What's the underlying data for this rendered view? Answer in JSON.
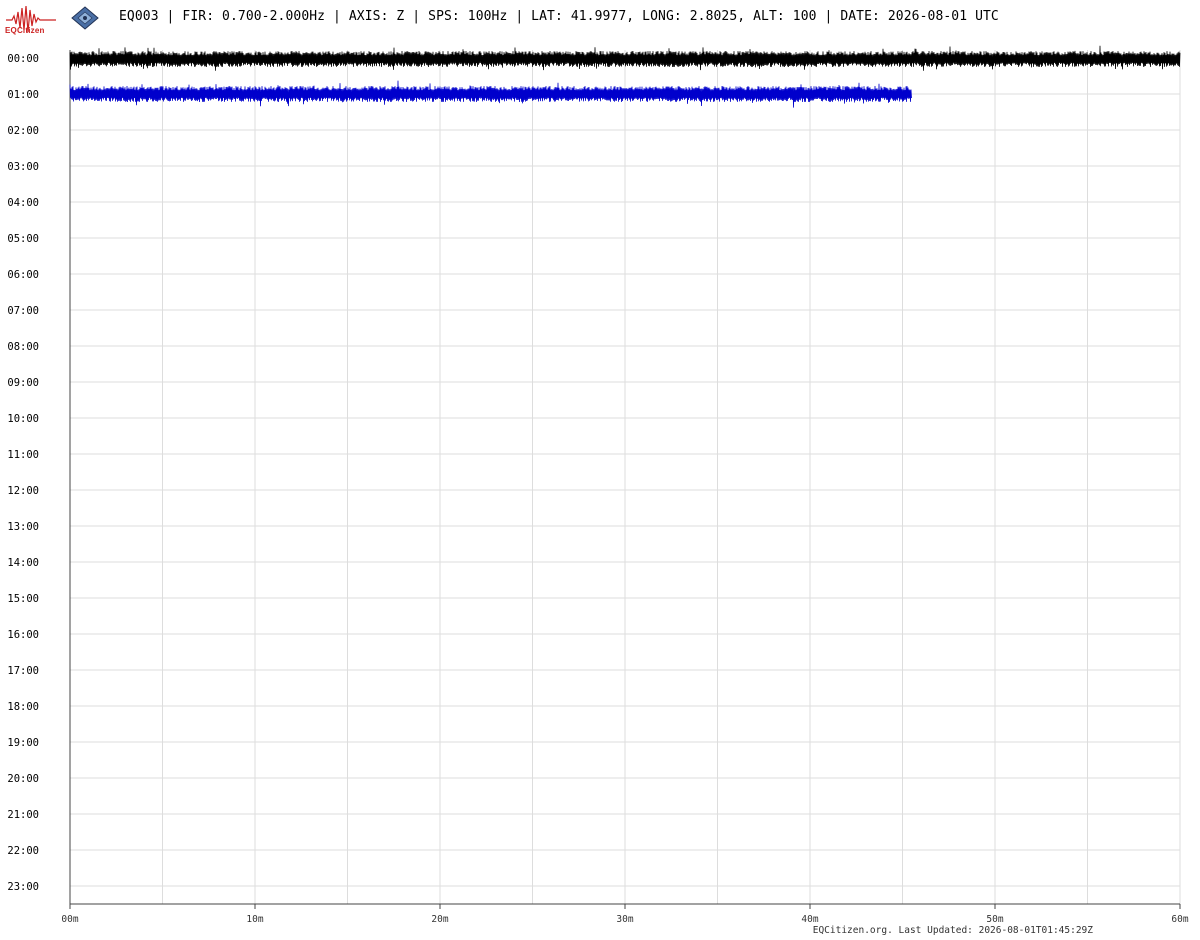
{
  "header": {
    "title": "EQ003 | FIR: 0.700-2.000Hz | AXIS: Z | SPS: 100Hz | LAT: 41.9977, LONG: 2.8025, ALT: 100 | DATE: 2026-08-01 UTC",
    "logo_text": "EQCitizen"
  },
  "icons": [
    "seismograph-logo-icon",
    "sensor-board-icon"
  ],
  "footer": {
    "text": "EQCitizen.org. Last Updated: 2026-08-01T01:45:29Z"
  },
  "chart_data": {
    "type": "line",
    "subtype": "helicorder",
    "x_axis": {
      "range": [
        0,
        60
      ],
      "unit": "minutes",
      "tick_values": [
        0,
        10,
        20,
        30,
        40,
        50,
        60
      ],
      "tick_labels": [
        "00m",
        "10m",
        "20m",
        "30m",
        "40m",
        "50m",
        "60m"
      ],
      "gridline_interval": 5
    },
    "y_axis": {
      "row_labels": [
        "00:00",
        "01:00",
        "02:00",
        "03:00",
        "04:00",
        "05:00",
        "06:00",
        "07:00",
        "08:00",
        "09:00",
        "10:00",
        "11:00",
        "12:00",
        "13:00",
        "14:00",
        "15:00",
        "16:00",
        "17:00",
        "18:00",
        "19:00",
        "20:00",
        "21:00",
        "22:00",
        "23:00"
      ]
    },
    "grid": true,
    "series": [
      {
        "row": "00:00",
        "start_min": 0,
        "end_min": 60,
        "color": "#000000"
      },
      {
        "row": "01:00",
        "start_min": 0,
        "end_min": 45.5,
        "color": "#0000cc"
      }
    ],
    "colors": {
      "grid": "#dddddd",
      "axis": "#444444",
      "tick_label": "#000000"
    }
  }
}
